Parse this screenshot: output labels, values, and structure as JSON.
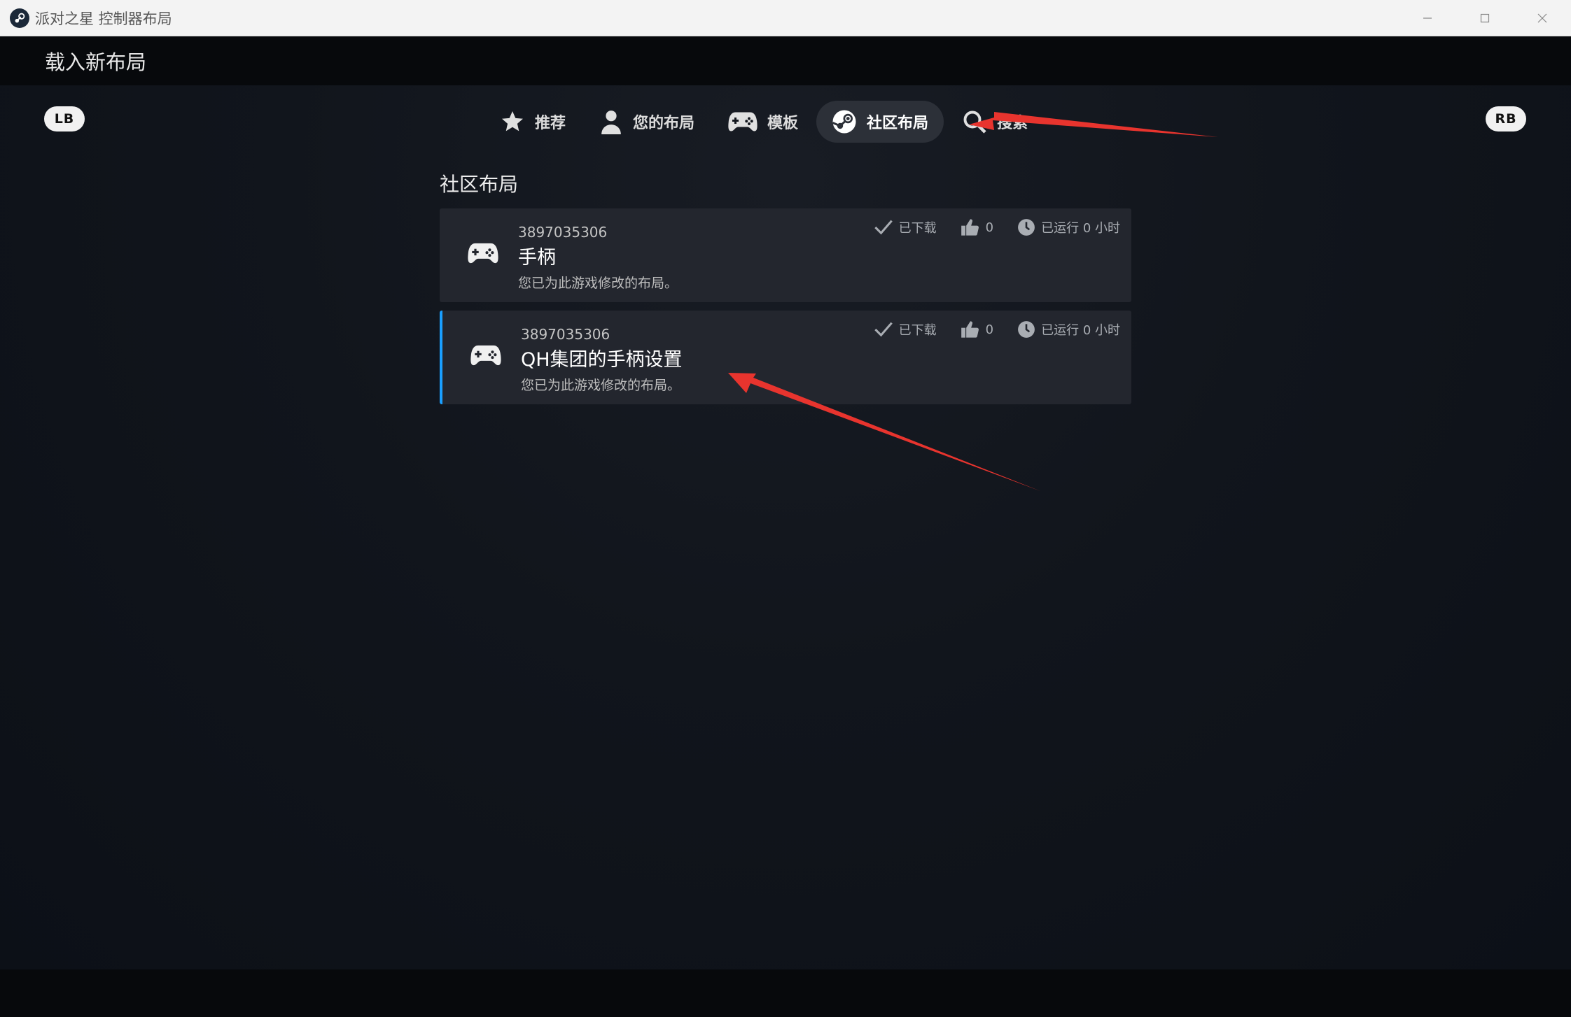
{
  "window": {
    "title": "派对之星 控制器布局"
  },
  "header": {
    "title": "载入新布局"
  },
  "bumpers": {
    "left": "LB",
    "right": "RB"
  },
  "tabs": [
    {
      "label": "推荐",
      "icon": "star-icon",
      "active": false
    },
    {
      "label": "您的布局",
      "icon": "user-icon",
      "active": false
    },
    {
      "label": "模板",
      "icon": "gamepad-icon",
      "active": false
    },
    {
      "label": "社区布局",
      "icon": "steam-icon",
      "active": true
    },
    {
      "label": "搜索",
      "icon": "search-icon",
      "active": false
    }
  ],
  "section": {
    "title": "社区布局"
  },
  "layouts": [
    {
      "id": "3897035306",
      "name": "手柄",
      "description": "您已为此游戏修改的布局。",
      "downloaded": "已下载",
      "likes": "0",
      "playtime": "已运行 0 小时"
    },
    {
      "id": "3897035306",
      "name": "QH集团的手柄设置",
      "description": "您已为此游戏修改的布局。",
      "downloaded": "已下载",
      "likes": "0",
      "playtime": "已运行 0 小时"
    }
  ],
  "colors": {
    "accent": "#1a9fff",
    "annotation_arrow": "#e8342e",
    "card_bg": "#23262e",
    "header_bg": "#07090c"
  }
}
